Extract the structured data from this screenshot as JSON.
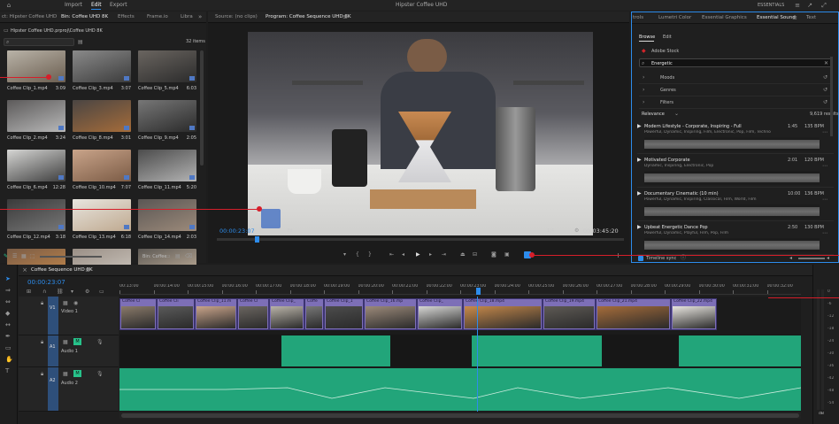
{
  "menu": {
    "home_icon": "home-icon",
    "import": "Import",
    "edit": "Edit",
    "export": "Export",
    "app_title": "Hipster Coffee UHD",
    "workspace": "ESSENTIALS"
  },
  "project_panel": {
    "tabs": [
      "ct: Hipster Coffee UHD",
      "Bin: Coffee UHD 8K",
      "Effects",
      "Frame.io",
      "Libra"
    ],
    "path": "Hipster Coffee UHD.prproj\\Coffee UHD 8K",
    "items_count": "32 items",
    "clips": [
      {
        "name": "Coffee Clip_1.mp4",
        "dur": "3:09"
      },
      {
        "name": "Coffee Clip_3.mp4",
        "dur": "3:07"
      },
      {
        "name": "Coffee Clip_5.mp4",
        "dur": "6:03"
      },
      {
        "name": "Coffee Clip_2.mp4",
        "dur": "3:24"
      },
      {
        "name": "Coffee Clip_8.mp4",
        "dur": "3:01"
      },
      {
        "name": "Coffee Clip_9.mp4",
        "dur": "2:05"
      },
      {
        "name": "Coffee Clip_6.mp4",
        "dur": "12:28"
      },
      {
        "name": "Coffee Clip_10.mp4",
        "dur": "7:07"
      },
      {
        "name": "Coffee Clip_11.mp4",
        "dur": "5:20"
      },
      {
        "name": "Coffee Clip_12.mp4",
        "dur": "3:18"
      },
      {
        "name": "Coffee Clip_13.mp4",
        "dur": "6:18"
      },
      {
        "name": "Coffee Clip_14.mp4",
        "dur": "2:03"
      },
      {
        "name": "Coffee Clip_15.mp4",
        "dur": "6:04"
      },
      {
        "name": "",
        "dur": ""
      },
      {
        "name": "",
        "dur": ""
      }
    ],
    "bin_label": "Bin: Coffee"
  },
  "source_tab": "Source: (no clips)",
  "program_tab": "Program: Coffee Sequence UHD 8K",
  "program": {
    "timecode": "00:00:23:07",
    "fit": "Fit",
    "page": "1/4",
    "duration": "00:03:45:20"
  },
  "essential_sound": {
    "tabs": [
      "trols",
      "Lumetri Color",
      "Essential Graphics",
      "Essential Sound",
      "Text"
    ],
    "subtabs": [
      "Browse",
      "Edit"
    ],
    "adobe_stock": "Adobe Stock",
    "search_value": "Energetic",
    "filters": [
      "Moods",
      "Genres",
      "Filters"
    ],
    "sort": "Relevance",
    "results": "9,619 results",
    "tracks": [
      {
        "title": "Modern Lifestyle - Corporate, Inspiring - Full",
        "tags": "Powerful, Dynamic, Inspiring, Film, Electronic, Pop, Film, Techno",
        "time": "1:45",
        "bpm": "135 BPM"
      },
      {
        "title": "Motivated Corporate",
        "tags": "Dynamic, Inspiring, Electronic, Pop",
        "time": "2:01",
        "bpm": "120 BPM"
      },
      {
        "title": "Documentary Cinematic (10 min)",
        "tags": "Powerful, Dynamic, Inspiring, Classical, Film, World, Film",
        "time": "10:00",
        "bpm": "136 BPM"
      },
      {
        "title": "Upbeat Energetic Dance Pop",
        "tags": "Powerful, Dynamic, Playful, Film, Pop, Film",
        "time": "2:50",
        "bpm": "130 BPM"
      }
    ],
    "timeline_sync": "Timeline sync"
  },
  "timeline": {
    "tab": "Coffee Sequence UHD 8K",
    "timecode": "00:00:23:07",
    "ruler": [
      "00:13:00",
      "00:00:14:00",
      "00:00:15:00",
      "00:00:16:00",
      "00:00:17:00",
      "00:00:18:00",
      "00:00:19:00",
      "00:00:20:00",
      "00:00:21:00",
      "00:00:22:00",
      "00:00:23:00",
      "00:00:24:00",
      "00:00:25:00",
      "00:00:26:00",
      "00:00:27:00",
      "00:00:28:00",
      "00:00:29:00",
      "00:00:30:00",
      "00:00:31:00",
      "00:00:32:00"
    ],
    "tracks": {
      "v1": "V1",
      "v1_name": "Video 1",
      "a1": "A1",
      "a1_name": "Audio 1",
      "a2": "A2",
      "a2_name": "Audio 2",
      "m": "M"
    },
    "video_clips": [
      "Coffee Cl",
      "Coffee Cli",
      "Coffee Clip_11.m",
      "Coffee Cl",
      "Coffee Clip_",
      "Coffe",
      "Coffee Clip_1",
      "Coffee Clip_16.mp",
      "Coffee Clip_",
      "Coffee Clip_18.mp4",
      "Coffee Clip_19.mp4",
      "Coffee Clip_21.mp4",
      "Coffee Clip_22.mp4"
    ]
  },
  "meter_labels": [
    "0",
    "-6",
    "-12",
    "-18",
    "-24",
    "-30",
    "-36",
    "-42",
    "-48",
    "-54"
  ],
  "meter_footer": "dB",
  "colors": {
    "accent": "#2d8ceb",
    "clip_video": "#7d6fb7",
    "clip_audio": "#22a57a",
    "playhead": "#2d8ceb",
    "callout": "#d61e2a"
  }
}
